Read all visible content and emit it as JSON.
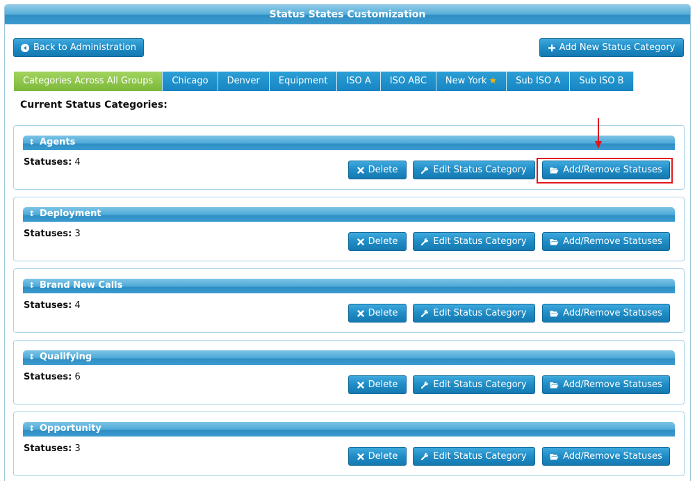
{
  "window": {
    "title": "Status States Customization"
  },
  "toolbar": {
    "back_label": "Back to Administration",
    "add_category_label": "Add New Status Category"
  },
  "tabs": [
    {
      "label": "Categories Across All Groups",
      "active": true
    },
    {
      "label": "Chicago"
    },
    {
      "label": "Denver"
    },
    {
      "label": "Equipment"
    },
    {
      "label": "ISO A"
    },
    {
      "label": "ISO ABC"
    },
    {
      "label": "New York",
      "starred": true
    },
    {
      "label": "Sub ISO A"
    },
    {
      "label": "Sub ISO B"
    }
  ],
  "section": {
    "heading": "Current Status Categories:"
  },
  "categories": [
    {
      "name": "Agents",
      "statuses_label": "Statuses:",
      "statuses_count": "4"
    },
    {
      "name": "Deployment",
      "statuses_label": "Statuses:",
      "statuses_count": "3"
    },
    {
      "name": "Brand New Calls",
      "statuses_label": "Statuses:",
      "statuses_count": "4"
    },
    {
      "name": "Qualifying",
      "statuses_label": "Statuses:",
      "statuses_count": "6"
    },
    {
      "name": "Opportunity",
      "statuses_label": "Statuses:",
      "statuses_count": "3"
    }
  ],
  "actions": {
    "delete_label": "Delete",
    "edit_label": "Edit Status Category",
    "add_remove_label": "Add/Remove Statuses"
  },
  "icons": {
    "back": "arrow-left-circle-icon",
    "add": "plus-icon",
    "delete": "x-icon",
    "edit": "wrench-icon",
    "add_remove": "folder-open-icon",
    "grip": "vertical-resize-icon",
    "starred": "star-icon"
  },
  "colors": {
    "accent_blue": "#1f8cc6",
    "active_tab_green": "#7cb83a",
    "highlight_red": "#e0161b",
    "star_gold": "#f7b500"
  }
}
